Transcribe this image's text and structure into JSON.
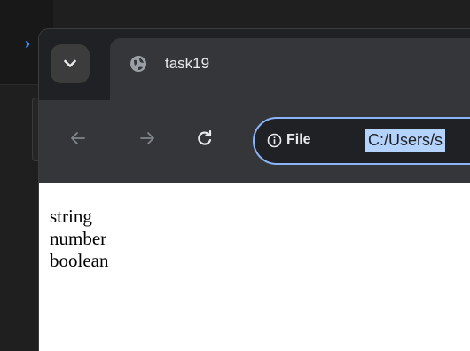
{
  "browser": {
    "tab": {
      "title": "task19",
      "favicon": "globe-icon"
    },
    "toolbar": {
      "back_icon": "arrow-left-icon",
      "forward_icon": "arrow-right-icon",
      "reload_icon": "reload-icon",
      "site_info_label": "File",
      "site_info_icon": "info-circle-icon",
      "url": "C:/Users/s"
    }
  },
  "page": {
    "lines": [
      "string",
      "number",
      "boolean"
    ]
  },
  "colors": {
    "tab_strip": "#202124",
    "toolbar": "#35363a",
    "omnibox_border": "#8ab4f8",
    "selection": "#b3d3fd",
    "editor_accent": "#3794ff"
  }
}
